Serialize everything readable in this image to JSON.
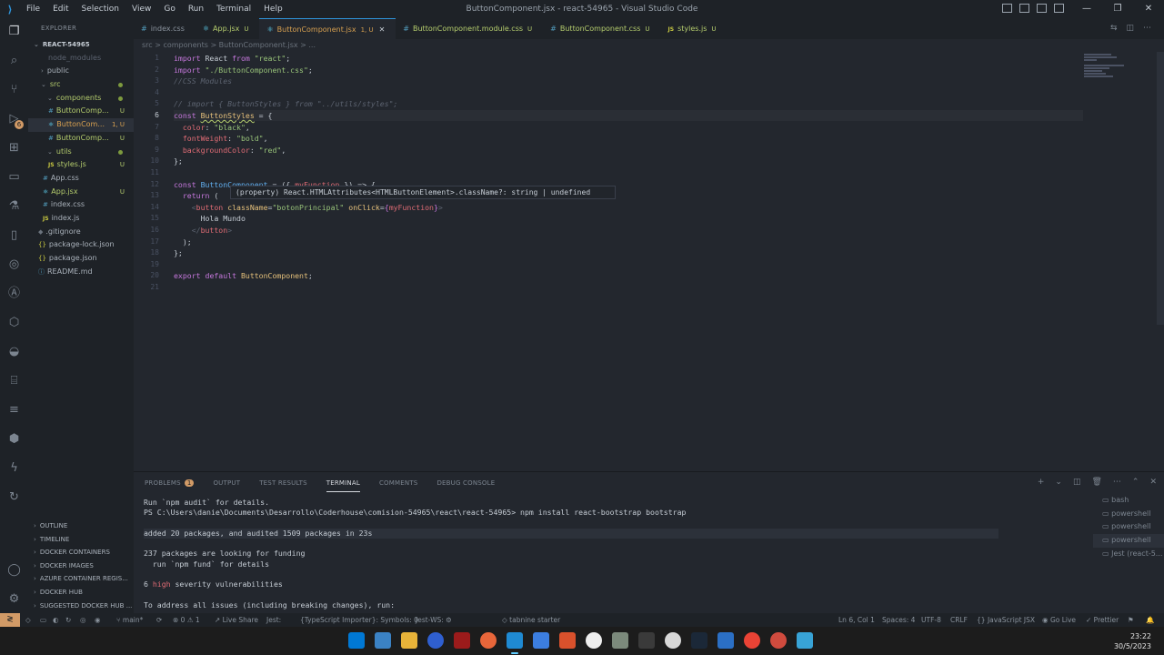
{
  "window": {
    "title": "ButtonComponent.jsx - react-54965 - Visual Studio Code",
    "menu": [
      "File",
      "Edit",
      "Selection",
      "View",
      "Go",
      "Run",
      "Terminal",
      "Help"
    ]
  },
  "sidebar": {
    "header": "EXPLORER",
    "root": "REACT-54965",
    "items": [
      {
        "label": "node_modules",
        "status": ""
      },
      {
        "label": "public",
        "status": ""
      },
      {
        "label": "src",
        "status": ""
      },
      {
        "label": "components",
        "status": ""
      },
      {
        "label": "ButtonComp...",
        "status": "U"
      },
      {
        "label": "ButtonCom...",
        "status": "1, U"
      },
      {
        "label": "ButtonComp...",
        "status": "U"
      },
      {
        "label": "utils",
        "status": ""
      },
      {
        "label": "styles.js",
        "status": "U"
      },
      {
        "label": "App.css",
        "status": ""
      },
      {
        "label": "App.jsx",
        "status": "U"
      },
      {
        "label": "index.css",
        "status": ""
      },
      {
        "label": "index.js",
        "status": ""
      },
      {
        "label": ".gitignore",
        "status": ""
      },
      {
        "label": "package-lock.json",
        "status": ""
      },
      {
        "label": "package.json",
        "status": ""
      },
      {
        "label": "README.md",
        "status": ""
      }
    ],
    "sections": [
      "OUTLINE",
      "TIMELINE",
      "DOCKER CONTAINERS",
      "DOCKER IMAGES",
      "AZURE CONTAINER REGIS...",
      "DOCKER HUB",
      "SUGGESTED DOCKER HUB ..."
    ]
  },
  "activity_badge": "6",
  "tabs": [
    {
      "label": "index.css",
      "status": "",
      "icon": "css"
    },
    {
      "label": "App.jsx",
      "status": "U",
      "icon": "react"
    },
    {
      "label": "ButtonComponent.jsx",
      "status": "1, U",
      "icon": "react",
      "active": true
    },
    {
      "label": "ButtonComponent.module.css",
      "status": "U",
      "icon": "css"
    },
    {
      "label": "ButtonComponent.css",
      "status": "U",
      "icon": "css"
    },
    {
      "label": "styles.js",
      "status": "U",
      "icon": "js"
    }
  ],
  "breadcrumb": "src > components > ButtonComponent.jsx > ...",
  "editor": {
    "line_numbers": [
      "1",
      "2",
      "3",
      "4",
      "5",
      "6",
      "7",
      "8",
      "9",
      "10",
      "11",
      "12",
      "13",
      "14",
      "15",
      "16",
      "17",
      "18",
      "19",
      "20",
      "21"
    ],
    "current_line": "6",
    "hover": "(property) React.HTMLAttributes<HTMLButtonElement>.className?: string | undefined"
  },
  "panel": {
    "tabs": [
      "PROBLEMS",
      "OUTPUT",
      "TEST RESULTS",
      "TERMINAL",
      "COMMENTS",
      "DEBUG CONSOLE"
    ],
    "problems_count": "1",
    "active_tab": "TERMINAL",
    "terminal": {
      "l1": "Run `npm audit` for details.",
      "l2": "PS C:\\Users\\danie\\Documents\\Desarrollo\\Coderhouse\\comision-54965\\react\\react-54965> npm install react-bootstrap bootstrap",
      "l3": "added 20 packages, and audited 1509 packages in 23s",
      "l4": "237 packages are looking for funding",
      "l5": "  run `npm fund` for details",
      "l6a": "6 ",
      "l6b": "high",
      "l6c": " severity vulnerabilities",
      "l7": "To address all issues (including breaking changes), run:"
    },
    "shells": [
      "bash",
      "powershell",
      "powershell",
      "powershell",
      "Jest (react-5..."
    ]
  },
  "statusbar": {
    "branch": "main*",
    "errors": "⊗ 0 ⚠ 1",
    "live_share": "Live Share",
    "jest": "Jest:",
    "ts_importer": "{TypeScript Importer}: Symbols: 0",
    "jest_ws": "Jest-WS: ⚙",
    "tabnine": "tabnine starter",
    "position": "Ln 6, Col 1",
    "spaces": "Spaces: 4",
    "encoding": "UTF-8",
    "eol": "CRLF",
    "language": "JavaScript JSX",
    "go_live": "Go Live",
    "prettier": "Prettier"
  },
  "taskbar": {
    "time": "23:22",
    "date": "30/5/2023"
  }
}
